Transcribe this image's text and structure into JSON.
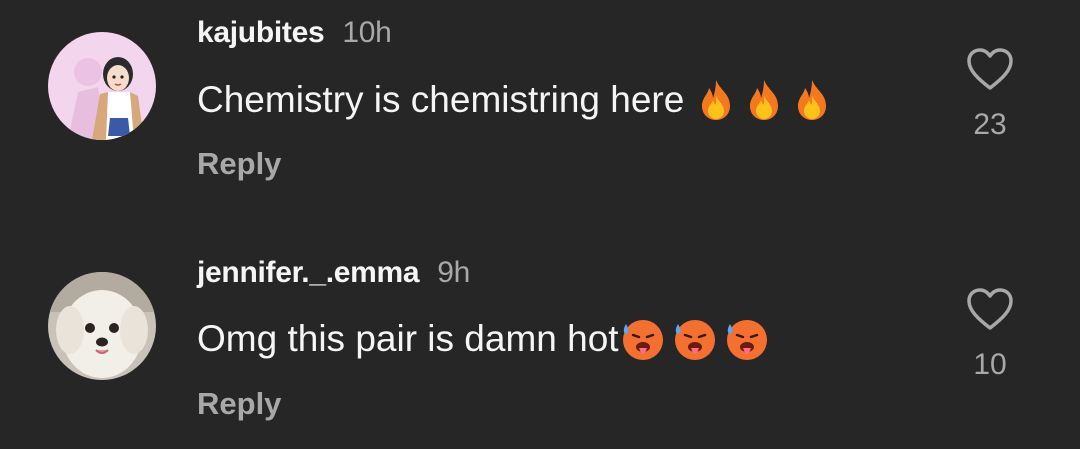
{
  "comments": [
    {
      "username": "kajubites",
      "time": "10h",
      "text": "Chemistry is chemistring here",
      "emojis": [
        "fire-icon",
        "fire-icon",
        "fire-icon"
      ],
      "reply_label": "Reply",
      "likes": "23",
      "avatar": "cartoon-girl-avatar"
    },
    {
      "username": "jennifer._.emma",
      "time": "9h",
      "text": "Omg this pair is damn hot",
      "emojis": [
        "hot-face-icon",
        "hot-face-icon",
        "hot-face-icon"
      ],
      "reply_label": "Reply",
      "likes": "10",
      "avatar": "white-puppy-avatar"
    }
  ],
  "colors": {
    "background": "#262626",
    "primary_text": "#f5f5f5",
    "secondary_text": "#a8a8a8"
  }
}
